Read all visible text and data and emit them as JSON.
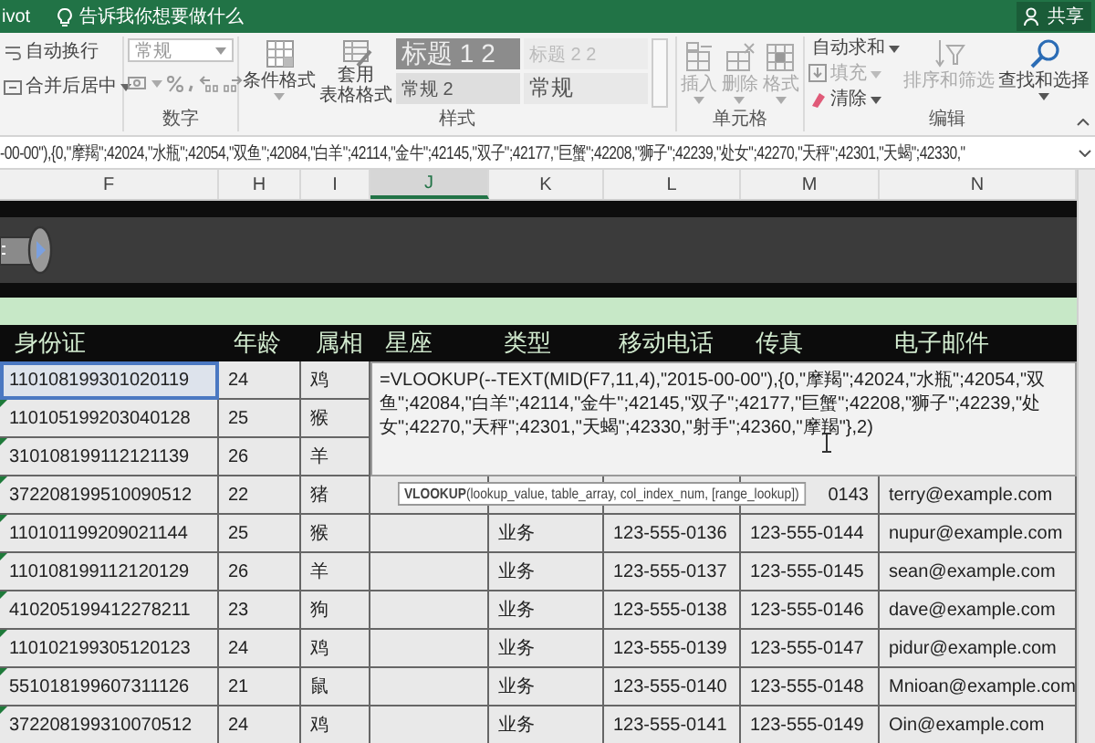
{
  "title_bar": {
    "tab_fragment": "ivot",
    "tell_me": "告诉我你想要做什么",
    "share_button": "共享"
  },
  "ribbon": {
    "alignment": {
      "items": [
        {
          "label": "自动换行",
          "kind": "wrap"
        },
        {
          "label": "合并后居中",
          "kind": "merge"
        }
      ]
    },
    "number": {
      "label": "数字",
      "format": "常规"
    },
    "styles": {
      "label": "样式",
      "conditional": "条件格式",
      "table_format_lines": [
        "套用",
        "表格格式"
      ],
      "gallery": [
        {
          "label": "标题 1 2",
          "kind": "heading1"
        },
        {
          "label": "标题 2 2",
          "kind": "heading2"
        },
        {
          "label": "常规 2",
          "kind": "normal"
        },
        {
          "label": "常规",
          "kind": "plain"
        }
      ]
    },
    "cells": {
      "label": "单元格",
      "buttons": [
        {
          "label": "插入",
          "kind": "insert",
          "disabled": true
        },
        {
          "label": "删除",
          "kind": "delete",
          "disabled": true
        },
        {
          "label": "格式",
          "kind": "format",
          "disabled": true
        }
      ]
    },
    "editing": {
      "label": "编辑",
      "items": [
        {
          "label": "自动求和",
          "kind": "autosum",
          "disabled": false
        },
        {
          "label": "填充",
          "kind": "fill",
          "disabled": true
        },
        {
          "label": "清除",
          "kind": "clear",
          "disabled": false
        }
      ],
      "sort": {
        "label": "排序和筛选",
        "disabled": true
      },
      "find": {
        "label": "查找和选择",
        "disabled": false
      }
    }
  },
  "formula_bar": {
    "text": "-00-00\"),{0,\"摩羯\";42024,\"水瓶\";42054,\"双鱼\";42084,\"白羊\";42114,\"金牛\";42145,\"双子\";42177,\"巨蟹\";42208,\"狮子\";42239,\"处女\";42270,\"天秤\";42301,\"天蝎\";42330,\""
  },
  "columns": [
    {
      "letter": "F",
      "selected": false
    },
    {
      "letter": "H",
      "selected": false
    },
    {
      "letter": "I",
      "selected": false
    },
    {
      "letter": "J",
      "selected": true
    },
    {
      "letter": "K",
      "selected": false
    },
    {
      "letter": "L",
      "selected": false
    },
    {
      "letter": "M",
      "selected": false
    },
    {
      "letter": "N",
      "selected": false
    }
  ],
  "header_row": [
    "身份证",
    "年龄",
    "属相",
    "星座",
    "类型",
    "移动电话",
    "传真",
    "电子邮件"
  ],
  "rows": [
    {
      "id": "110108199301020119",
      "age": "24",
      "zodiac": "鸡",
      "selected": true,
      "flagged": false
    },
    {
      "id": "110105199203040128",
      "age": "25",
      "zodiac": "猴",
      "selected": false,
      "flagged": true
    },
    {
      "id": "310108199112121139",
      "age": "26",
      "zodiac": "羊",
      "selected": false,
      "flagged": true
    },
    {
      "id": "372208199510090512",
      "age": "22",
      "zodiac": "猪",
      "selected": false,
      "flagged": true,
      "fax": "0143",
      "fax_covered": true,
      "email": "terry@example.com"
    },
    {
      "id": "110101199209021144",
      "age": "25",
      "zodiac": "猴",
      "selected": false,
      "flagged": true,
      "type": "业务",
      "mobile": "123-555-0136",
      "fax": "123-555-0144",
      "email": "nupur@example.com"
    },
    {
      "id": "110108199112120129",
      "age": "26",
      "zodiac": "羊",
      "selected": false,
      "flagged": true,
      "type": "业务",
      "mobile": "123-555-0137",
      "fax": "123-555-0145",
      "email": "sean@example.com"
    },
    {
      "id": "410205199412278211",
      "age": "23",
      "zodiac": "狗",
      "selected": false,
      "flagged": true,
      "type": "业务",
      "mobile": "123-555-0138",
      "fax": "123-555-0146",
      "email": "dave@example.com"
    },
    {
      "id": "110102199305120123",
      "age": "24",
      "zodiac": "鸡",
      "selected": false,
      "flagged": true,
      "type": "业务",
      "mobile": "123-555-0139",
      "fax": "123-555-0147",
      "email": "pidur@example.com"
    },
    {
      "id": "551018199607311126",
      "age": "21",
      "zodiac": "鼠",
      "selected": false,
      "flagged": true,
      "type": "业务",
      "mobile": "123-555-0140",
      "fax": "123-555-0148",
      "email": "Mnioan@example.com"
    },
    {
      "id": "372208199310070512",
      "age": "24",
      "zodiac": "鸡",
      "selected": false,
      "flagged": true,
      "type": "业务",
      "mobile": "123-555-0141",
      "fax": "123-555-0149",
      "email": "Oin@example.com"
    }
  ],
  "cell_editor": {
    "formula": "=VLOOKUP(--TEXT(MID(F7,11,4),\"2015-00-00\"),{0,\"摩羯\";42024,\"水瓶\";42054,\"双鱼\";42084,\"白羊\";42114,\"金牛\";42145,\"双子\";42177,\"巨蟹\";42208,\"狮子\";42239,\"处女\";42270,\"天秤\";42301,\"天蝎\";42330,\"射手\";42360,\"摩羯\"},2)"
  },
  "tooltip": "**VLOOKUP**(lookup_value, table_array, col_index_num, [range_lookup])"
}
